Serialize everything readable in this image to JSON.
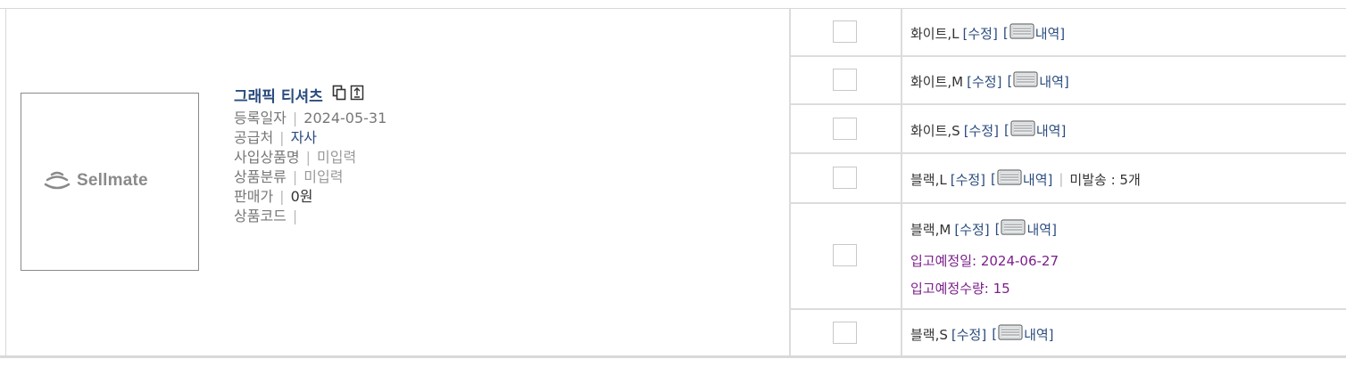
{
  "product": {
    "name": "그래픽 티셔츠",
    "image_logo_text": "Sellmate",
    "registered_label": "등록일자",
    "registered_value": "2024-05-31",
    "supplier_label": "공급처",
    "supplier_value": "자사",
    "purchase_name_label": "사입상품명",
    "purchase_name_value": "미입력",
    "category_label": "상품분류",
    "category_value": "미입력",
    "price_label": "판매가",
    "price_value": "0원",
    "code_label": "상품코드",
    "code_value": "",
    "separator": "|"
  },
  "options": [
    {
      "name": "화이트,L",
      "edit_label": "[수정]",
      "history_label": "내역]",
      "history_open": "["
    },
    {
      "name": "화이트,M",
      "edit_label": "[수정]",
      "history_label": "내역]",
      "history_open": "["
    },
    {
      "name": "화이트,S",
      "edit_label": "[수정]",
      "history_label": "내역]",
      "history_open": "["
    },
    {
      "name": "블랙,L",
      "edit_label": "[수정]",
      "history_label": "내역]",
      "history_open": "[",
      "unsent_sep": "|",
      "unsent": "미발송 : 5개"
    },
    {
      "name": "블랙,M",
      "edit_label": "[수정]",
      "history_label": "내역]",
      "history_open": "[",
      "expected_date": "입고예정일: 2024-06-27",
      "expected_qty": "입고예정수량: 15"
    },
    {
      "name": "블랙,S",
      "edit_label": "[수정]",
      "history_label": "내역]",
      "history_open": "["
    }
  ],
  "colors": {
    "link": "#2b4c7e",
    "expected": "#7b1f8a",
    "border": "#dcdcdc"
  }
}
